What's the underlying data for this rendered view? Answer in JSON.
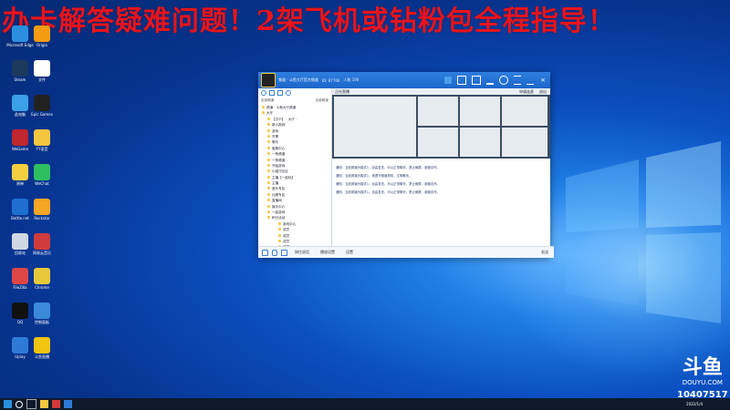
{
  "banner": {
    "text": "办卡解答疑难问题！2架飞机或钻粉包全程指导！"
  },
  "desktop_icons": [
    {
      "label": "Microsoft Edge",
      "color": "#2b8fe0"
    },
    {
      "label": "Steam",
      "color": "#1b3a5c"
    },
    {
      "label": "此电脑",
      "color": "#3aa0e8"
    },
    {
      "label": "WeGame",
      "color": "#c0262d"
    },
    {
      "label": "原神",
      "color": "#f4d03f"
    },
    {
      "label": "Battle.net",
      "color": "#1f6fd1"
    },
    {
      "label": "回收站",
      "color": "#cfd8e3"
    },
    {
      "label": "FileZilla",
      "color": "#e04545"
    },
    {
      "label": "QQ",
      "color": "#111111"
    },
    {
      "label": "Uplay",
      "color": "#2e7bd6"
    },
    {
      "label": "Origin",
      "color": "#f39c12"
    },
    {
      "label": "文件",
      "color": "#ffffff"
    },
    {
      "label": "Epic Games",
      "color": "#222222"
    },
    {
      "label": "YY语音",
      "color": "#f5c542"
    },
    {
      "label": "WeChat",
      "color": "#2dbf60"
    },
    {
      "label": "Rockstar",
      "color": "#f5a623"
    },
    {
      "label": "网易云音乐",
      "color": "#d23b3b"
    },
    {
      "label": "Chrome",
      "color": "#e8c93a"
    },
    {
      "label": "控制面板",
      "color": "#3b8ad9"
    },
    {
      "label": "斗鱼直播",
      "color": "#f1c40f"
    }
  ],
  "app": {
    "title": "频道 · 斗鱼大厅官方频道",
    "channel_id": "ID: 87766",
    "online": "人数 190",
    "left_tab_1": "全部频道",
    "left_tab_2": "全部频道",
    "tree": [
      "频道 · 斗鱼大厅频道",
      "大厅",
      "【办卡】 · 大厅 ·",
      "新人报到",
      "游戏",
      "开黑",
      "聊天",
      "客服中心",
      "一条频道",
      "一条频道",
      "开始游戏",
      "小组讨论区",
      "主播【一起玩】",
      "主播",
      "音乐专区",
      "比赛专区",
      "直播间",
      "娱乐中心",
      "一起游戏",
      "积分活动",
      "游戏中心",
      "成员",
      "成员",
      "成员",
      "成员",
      "成员"
    ],
    "video_header": "正在直播",
    "video_right_label_1": "申请连麦",
    "video_right_label_2": "退出",
    "chat": [
      "通知：当前频道为模式1，自由发言，可以正常聊天，禁止刷屏，谢谢合作。",
      "通知：当前频道为模式1，请遵守频道规则，文明聊天。",
      "通知：当前频道为模式1，自由发言，可以正常聊天，禁止刷屏，谢谢合作。",
      "通知：当前频道为模式1，自由发言，可以正常聊天，禁止刷屏，谢谢合作。"
    ],
    "bottom": {
      "mic_label": "按住说话",
      "settings_label": "播放设置",
      "setup_label": "设置",
      "send_label": "发送"
    }
  },
  "watermark": {
    "brand": "斗鱼",
    "site": "DOUYU.COM",
    "room": "10407517"
  },
  "taskbar": {
    "time": "2022/1/4",
    "search_icon": "search-icon"
  }
}
